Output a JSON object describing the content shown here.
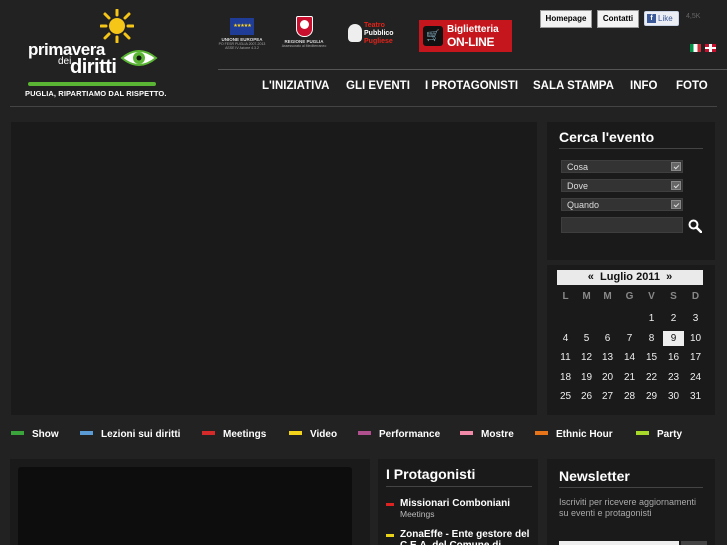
{
  "logo": {
    "line1": "primavera",
    "line2a": "dei",
    "line2b": "diritti",
    "tagline": "PUGLIA, RIPARTIAMO DAL RISPETTO."
  },
  "sponsors": {
    "eu": {
      "label": "UNIONE EUROPEA",
      "sub1": "PO FESR PUGLIA 2007-2013",
      "sub2": "ASSE IV Azione 4.3.2"
    },
    "puglia": {
      "label": "REGIONE PUGLIA",
      "sub1": "Assessorato al Mediterraneo"
    },
    "teatro": {
      "line1": "Teatro",
      "line2": "Pubblico",
      "line3": "Pugliese"
    },
    "biglietteria": {
      "line1": "Biglietteria",
      "line2": "ON-LINE"
    }
  },
  "topbar": {
    "home_label": "Homepage",
    "contatti_label": "Contatti",
    "like_label": "Like",
    "like_count": "4,5K"
  },
  "nav": {
    "items": [
      {
        "label": "L'INIZIATIVA"
      },
      {
        "label": "GLI EVENTI"
      },
      {
        "label": "I PROTAGONISTI"
      },
      {
        "label": "SALA STAMPA"
      },
      {
        "label": "INFO"
      },
      {
        "label": "FOTO"
      }
    ]
  },
  "search": {
    "title": "Cerca l'evento",
    "fields": [
      {
        "label": "Cosa"
      },
      {
        "label": "Dove"
      },
      {
        "label": "Quando"
      }
    ]
  },
  "calendar": {
    "prev": "«",
    "month": "Luglio 2011",
    "next": "»",
    "weekdays": [
      "L",
      "M",
      "M",
      "G",
      "V",
      "S",
      "D"
    ],
    "today": "9",
    "rows": [
      [
        "",
        "",
        "",
        "",
        "1",
        "2",
        "3"
      ],
      [
        "4",
        "5",
        "6",
        "7",
        "8",
        "9",
        "10"
      ],
      [
        "11",
        "12",
        "13",
        "14",
        "15",
        "16",
        "17"
      ],
      [
        "18",
        "19",
        "20",
        "21",
        "22",
        "23",
        "24"
      ],
      [
        "25",
        "26",
        "27",
        "28",
        "29",
        "30",
        "31"
      ]
    ]
  },
  "categories": [
    {
      "label": "Show",
      "color": "#3aa53a"
    },
    {
      "label": "Lezioni sui diritti",
      "color": "#5b9bd5"
    },
    {
      "label": "Meetings",
      "color": "#d42a2a"
    },
    {
      "label": "Video",
      "color": "#f2d21a"
    },
    {
      "label": "Performance",
      "color": "#b0508f"
    },
    {
      "label": "Mostre",
      "color": "#f08aa8"
    },
    {
      "label": "Ethnic Hour",
      "color": "#e8741a"
    },
    {
      "label": "Party",
      "color": "#a8d82a"
    }
  ],
  "protagonisti": {
    "title": "I Protagonisti",
    "items": [
      {
        "name": "Missionari Comboniani",
        "type": "Meetings"
      },
      {
        "name": "ZonaEffe - Ente gestore del",
        "type": "C.E.A. del Comune di"
      }
    ]
  },
  "newsletter": {
    "title": "Newsletter",
    "description": "Iscriviti per ricevere aggiornamenti su eventi e protagonisti"
  }
}
